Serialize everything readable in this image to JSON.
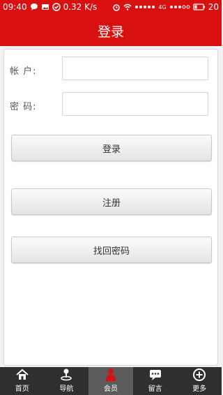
{
  "status": {
    "time": "09:40",
    "speed": "0.32 K/s",
    "network": "4G",
    "battery": "20"
  },
  "header": {
    "title": "登录"
  },
  "form": {
    "account_label": "帐 户:",
    "account_value": "",
    "password_label": "密 码:",
    "password_value": ""
  },
  "buttons": {
    "login": "登录",
    "register": "注册",
    "recover": "找回密码"
  },
  "tabs": [
    {
      "label": "首页",
      "icon": "home-icon"
    },
    {
      "label": "导航",
      "icon": "navigation-icon"
    },
    {
      "label": "会员",
      "icon": "member-icon"
    },
    {
      "label": "留言",
      "icon": "message-icon"
    },
    {
      "label": "更多",
      "icon": "more-icon"
    }
  ],
  "colors": {
    "brand": "#d81010",
    "tabbar": "#2f2f2f",
    "member_icon": "#d81010"
  }
}
